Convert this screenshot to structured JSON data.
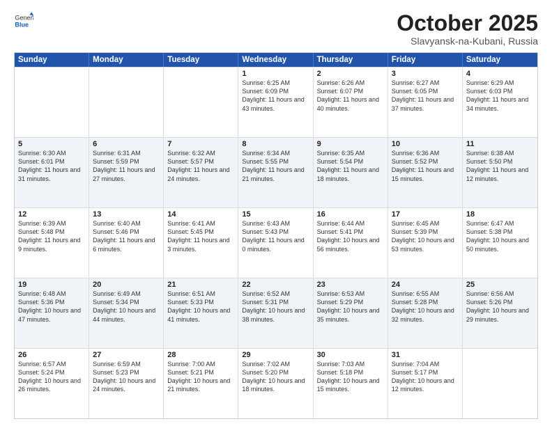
{
  "logo": {
    "general": "General",
    "blue": "Blue"
  },
  "title": "October 2025",
  "subtitle": "Slavyansk-na-Kubani, Russia",
  "headers": [
    "Sunday",
    "Monday",
    "Tuesday",
    "Wednesday",
    "Thursday",
    "Friday",
    "Saturday"
  ],
  "rows": [
    [
      {
        "day": "",
        "text": ""
      },
      {
        "day": "",
        "text": ""
      },
      {
        "day": "",
        "text": ""
      },
      {
        "day": "1",
        "text": "Sunrise: 6:25 AM\nSunset: 6:09 PM\nDaylight: 11 hours and 43 minutes."
      },
      {
        "day": "2",
        "text": "Sunrise: 6:26 AM\nSunset: 6:07 PM\nDaylight: 11 hours and 40 minutes."
      },
      {
        "day": "3",
        "text": "Sunrise: 6:27 AM\nSunset: 6:05 PM\nDaylight: 11 hours and 37 minutes."
      },
      {
        "day": "4",
        "text": "Sunrise: 6:29 AM\nSunset: 6:03 PM\nDaylight: 11 hours and 34 minutes."
      }
    ],
    [
      {
        "day": "5",
        "text": "Sunrise: 6:30 AM\nSunset: 6:01 PM\nDaylight: 11 hours and 31 minutes."
      },
      {
        "day": "6",
        "text": "Sunrise: 6:31 AM\nSunset: 5:59 PM\nDaylight: 11 hours and 27 minutes."
      },
      {
        "day": "7",
        "text": "Sunrise: 6:32 AM\nSunset: 5:57 PM\nDaylight: 11 hours and 24 minutes."
      },
      {
        "day": "8",
        "text": "Sunrise: 6:34 AM\nSunset: 5:55 PM\nDaylight: 11 hours and 21 minutes."
      },
      {
        "day": "9",
        "text": "Sunrise: 6:35 AM\nSunset: 5:54 PM\nDaylight: 11 hours and 18 minutes."
      },
      {
        "day": "10",
        "text": "Sunrise: 6:36 AM\nSunset: 5:52 PM\nDaylight: 11 hours and 15 minutes."
      },
      {
        "day": "11",
        "text": "Sunrise: 6:38 AM\nSunset: 5:50 PM\nDaylight: 11 hours and 12 minutes."
      }
    ],
    [
      {
        "day": "12",
        "text": "Sunrise: 6:39 AM\nSunset: 5:48 PM\nDaylight: 11 hours and 9 minutes."
      },
      {
        "day": "13",
        "text": "Sunrise: 6:40 AM\nSunset: 5:46 PM\nDaylight: 11 hours and 6 minutes."
      },
      {
        "day": "14",
        "text": "Sunrise: 6:41 AM\nSunset: 5:45 PM\nDaylight: 11 hours and 3 minutes."
      },
      {
        "day": "15",
        "text": "Sunrise: 6:43 AM\nSunset: 5:43 PM\nDaylight: 11 hours and 0 minutes."
      },
      {
        "day": "16",
        "text": "Sunrise: 6:44 AM\nSunset: 5:41 PM\nDaylight: 10 hours and 56 minutes."
      },
      {
        "day": "17",
        "text": "Sunrise: 6:45 AM\nSunset: 5:39 PM\nDaylight: 10 hours and 53 minutes."
      },
      {
        "day": "18",
        "text": "Sunrise: 6:47 AM\nSunset: 5:38 PM\nDaylight: 10 hours and 50 minutes."
      }
    ],
    [
      {
        "day": "19",
        "text": "Sunrise: 6:48 AM\nSunset: 5:36 PM\nDaylight: 10 hours and 47 minutes."
      },
      {
        "day": "20",
        "text": "Sunrise: 6:49 AM\nSunset: 5:34 PM\nDaylight: 10 hours and 44 minutes."
      },
      {
        "day": "21",
        "text": "Sunrise: 6:51 AM\nSunset: 5:33 PM\nDaylight: 10 hours and 41 minutes."
      },
      {
        "day": "22",
        "text": "Sunrise: 6:52 AM\nSunset: 5:31 PM\nDaylight: 10 hours and 38 minutes."
      },
      {
        "day": "23",
        "text": "Sunrise: 6:53 AM\nSunset: 5:29 PM\nDaylight: 10 hours and 35 minutes."
      },
      {
        "day": "24",
        "text": "Sunrise: 6:55 AM\nSunset: 5:28 PM\nDaylight: 10 hours and 32 minutes."
      },
      {
        "day": "25",
        "text": "Sunrise: 6:56 AM\nSunset: 5:26 PM\nDaylight: 10 hours and 29 minutes."
      }
    ],
    [
      {
        "day": "26",
        "text": "Sunrise: 6:57 AM\nSunset: 5:24 PM\nDaylight: 10 hours and 26 minutes."
      },
      {
        "day": "27",
        "text": "Sunrise: 6:59 AM\nSunset: 5:23 PM\nDaylight: 10 hours and 24 minutes."
      },
      {
        "day": "28",
        "text": "Sunrise: 7:00 AM\nSunset: 5:21 PM\nDaylight: 10 hours and 21 minutes."
      },
      {
        "day": "29",
        "text": "Sunrise: 7:02 AM\nSunset: 5:20 PM\nDaylight: 10 hours and 18 minutes."
      },
      {
        "day": "30",
        "text": "Sunrise: 7:03 AM\nSunset: 5:18 PM\nDaylight: 10 hours and 15 minutes."
      },
      {
        "day": "31",
        "text": "Sunrise: 7:04 AM\nSunset: 5:17 PM\nDaylight: 10 hours and 12 minutes."
      },
      {
        "day": "",
        "text": ""
      }
    ]
  ]
}
